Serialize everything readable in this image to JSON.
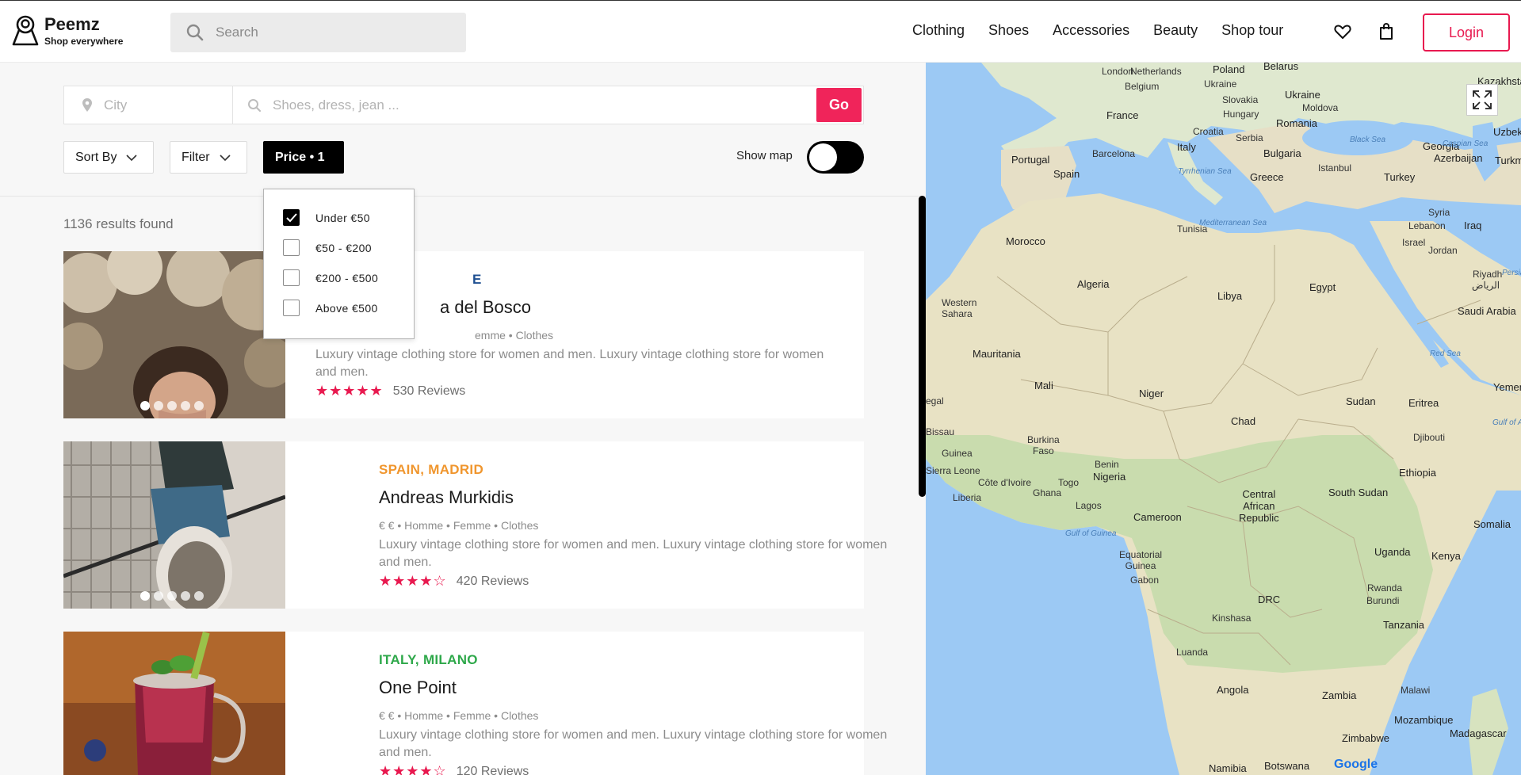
{
  "header": {
    "logo_name": "Peemz",
    "logo_tagline": "Shop everywhere",
    "search_placeholder": "Search",
    "nav": [
      "Clothing",
      "Shoes",
      "Accessories",
      "Beauty",
      "Shop tour"
    ],
    "login_label": "Login"
  },
  "filters": {
    "city_placeholder": "City",
    "product_placeholder": "Shoes, dress, jean ...",
    "go_label": "Go",
    "sort_label": "Sort By",
    "filter_label": "Filter",
    "price_label": "Price • 1",
    "show_map_label": "Show map",
    "show_map_on": true
  },
  "price_dropdown": {
    "options": [
      {
        "label": "Under €50",
        "checked": true
      },
      {
        "label": "€50 - €200",
        "checked": false
      },
      {
        "label": "€200 - €500",
        "checked": false
      },
      {
        "label": "Above €500",
        "checked": false
      }
    ]
  },
  "results": {
    "count_label": "1136 results found",
    "items": [
      {
        "location": "E",
        "location_color": "#1e4f91",
        "name": "a del Bosco",
        "meta": "emme  •  Clothes",
        "description": "Luxury vintage clothing store for women and men. Luxury vintage clothing store for women and men.",
        "stars": "★★★★★",
        "reviews": "530 Reviews"
      },
      {
        "location": "SPAIN, MADRID",
        "location_color": "#f0962e",
        "name": "Andreas Murkidis",
        "meta": "€ €  •  Homme  •  Femme  •  Clothes",
        "description": "Luxury vintage clothing store for women and men. Luxury vintage clothing store for women and men.",
        "stars": "★★★★☆",
        "reviews": "420 Reviews"
      },
      {
        "location": "ITALY, MILANO",
        "location_color": "#2ea84a",
        "name": "One Point",
        "meta": "€ €  •  Homme  •  Femme  •  Clothes",
        "description": "Luxury vintage clothing store for women and men. Luxury vintage clothing store for women and men.",
        "stars": "★★★★☆",
        "reviews": "120 Reviews"
      }
    ]
  },
  "map": {
    "labels": {
      "belarus": "Belarus",
      "netherlands": "Netherlands",
      "london": "London",
      "poland": "Poland",
      "belgium": "Belgium",
      "ukraine": "Ukraine",
      "slovakia": "Slovakia",
      "hungary": "Hungary",
      "moldova": "Moldova",
      "france": "France",
      "romania": "Romania",
      "croatia": "Croatia",
      "serbia": "Serbia",
      "italy": "Italy",
      "bulgaria": "Bulgaria",
      "georgia": "Georgia",
      "black_sea": "Black Sea",
      "caspian_sea": "Caspian Sea",
      "portugal": "Portugal",
      "barcelona": "Barcelona",
      "istanbul": "Istanbul",
      "azerbaijan": "Azerbaijan",
      "spain": "Spain",
      "tyrrhenian": "Tyrrhenian Sea",
      "greece": "Greece",
      "turkey": "Turkey",
      "turkmenistan": "Turkmen",
      "uzbek": "Uzbek",
      "kazakhstan": "Kazakhsta",
      "tunisia": "Tunisia",
      "mediterranean": "Mediterranean Sea",
      "syria": "Syria",
      "lebanon": "Lebanon",
      "iraq": "Iraq",
      "israel": "Israel",
      "jordan": "Jordan",
      "morocco": "Morocco",
      "algeria": "Algeria",
      "libya": "Libya",
      "egypt": "Egypt",
      "riyadh_ar": "الرياض",
      "riyadh": "Riyadh",
      "persian": "Persian G",
      "saudi": "Saudi Arabia",
      "western_sahara": "Western\nSahara",
      "mauritania": "Mauritania",
      "red_sea": "Red Sea",
      "mali": "Mali",
      "niger": "Niger",
      "sudan": "Sudan",
      "eritrea": "Eritrea",
      "yemen": "Yemen",
      "senegal": "egal",
      "chad": "Chad",
      "bissau": "Bissau",
      "djibouti": "Djibouti",
      "gulf_aden": "Gulf of A",
      "burkina": "Burkina\nFaso",
      "guinea": "Guinea",
      "benin": "Benin",
      "nigeria": "Nigeria",
      "sierra": "Sierra Leone",
      "ivoire": "Côte d'Ivoire",
      "togo": "Togo",
      "ethiopia": "Ethiopia",
      "liberia": "Liberia",
      "ghana": "Ghana",
      "central_african": "Central\nAfrican\nRepublic",
      "south_sudan": "South Sudan",
      "somalia": "Somalia",
      "lagos": "Lagos",
      "gulf_guinea": "Gulf of Guinea",
      "cameroon": "Cameroon",
      "eq_guinea": "Equatorial\nGuinea",
      "uganda": "Uganda",
      "kenya": "Kenya",
      "gabon": "Gabon",
      "drc": "DRC",
      "rwanda": "Rwanda",
      "burundi": "Burundi",
      "kinshasa": "Kinshasa",
      "tanzania": "Tanzania",
      "luanda": "Luanda",
      "malawi": "Malawi",
      "angola": "Angola",
      "zambia": "Zambia",
      "mozambique": "Mozambique",
      "zimbabwe": "Zimbabwe",
      "madagascar": "Madagascar",
      "namibia": "Namibia",
      "botswana": "Botswana"
    },
    "attribution": "Google"
  }
}
